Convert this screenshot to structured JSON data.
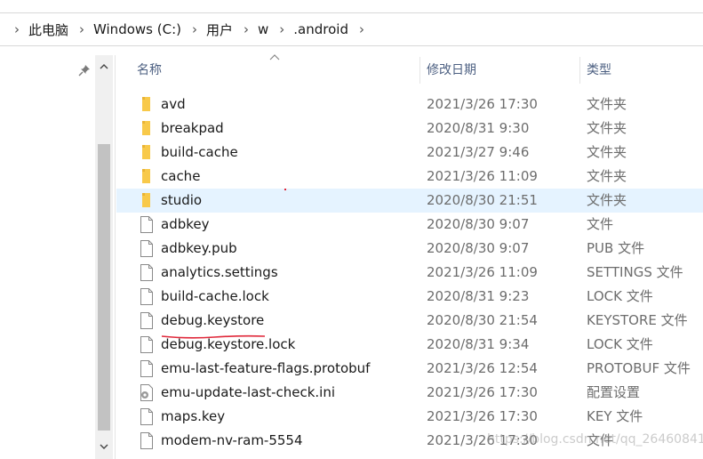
{
  "breadcrumb": [
    "此电脑",
    "Windows (C:)",
    "用户",
    "w",
    ".android"
  ],
  "columns": {
    "name": "名称",
    "date": "修改日期",
    "type": "类型"
  },
  "files": [
    {
      "name": "avd",
      "date": "2021/3/26 17:30",
      "type": "文件夹",
      "icon": "folder-icon"
    },
    {
      "name": "breakpad",
      "date": "2020/8/31 9:30",
      "type": "文件夹",
      "icon": "folder-icon"
    },
    {
      "name": "build-cache",
      "date": "2021/3/27 9:46",
      "type": "文件夹",
      "icon": "folder-icon"
    },
    {
      "name": "cache",
      "date": "2021/3/26 11:09",
      "type": "文件夹",
      "icon": "folder-icon"
    },
    {
      "name": "studio",
      "date": "2020/8/30 21:51",
      "type": "文件夹",
      "icon": "folder-icon",
      "selected": true
    },
    {
      "name": "adbkey",
      "date": "2020/8/30 9:07",
      "type": "文件",
      "icon": "file-icon"
    },
    {
      "name": "adbkey.pub",
      "date": "2020/8/30 9:07",
      "type": "PUB 文件",
      "icon": "file-icon"
    },
    {
      "name": "analytics.settings",
      "date": "2021/3/26 11:09",
      "type": "SETTINGS 文件",
      "icon": "file-icon"
    },
    {
      "name": "build-cache.lock",
      "date": "2020/8/31 9:23",
      "type": "LOCK 文件",
      "icon": "file-icon"
    },
    {
      "name": "debug.keystore",
      "date": "2020/8/30 21:54",
      "type": "KEYSTORE 文件",
      "icon": "file-icon",
      "underlined": true
    },
    {
      "name": "debug.keystore.lock",
      "date": "2020/8/31 9:34",
      "type": "LOCK 文件",
      "icon": "file-icon"
    },
    {
      "name": "emu-last-feature-flags.protobuf",
      "date": "2021/3/26 12:54",
      "type": "PROTOBUF 文件",
      "icon": "file-icon"
    },
    {
      "name": "emu-update-last-check.ini",
      "date": "2021/3/26 17:30",
      "type": "配置设置",
      "icon": "settings-file-icon"
    },
    {
      "name": "maps.key",
      "date": "2021/3/26 17:30",
      "type": "KEY 文件",
      "icon": "file-icon"
    },
    {
      "name": "modem-nv-ram-5554",
      "date": "2021/3/26 17:30",
      "type": "文件",
      "icon": "file-icon"
    }
  ],
  "watermark": "https://blog.csdn.net/qq_26460841",
  "colors": {
    "folder": "#f8c94a",
    "selected_row": "#e5f3ff",
    "header_text": "#4d6082",
    "annotation_red": "#e0283a"
  }
}
